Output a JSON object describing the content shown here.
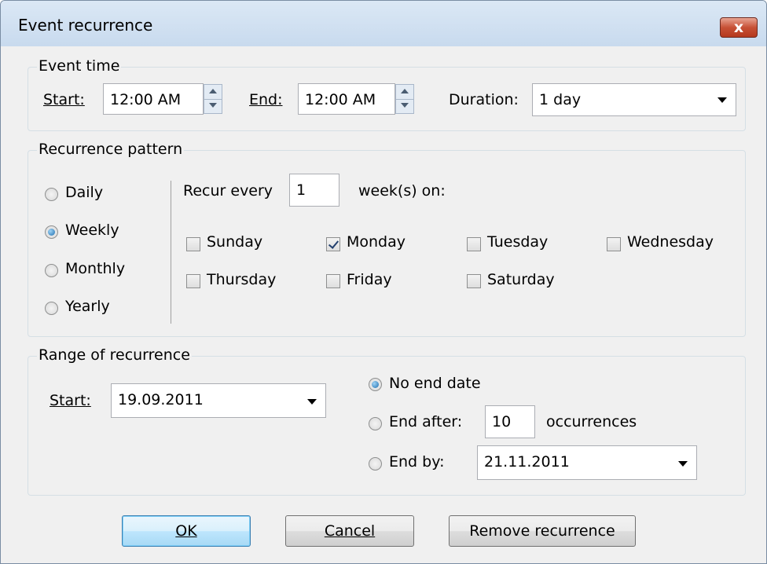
{
  "window": {
    "title": "Event recurrence",
    "close_label": "x"
  },
  "event_time": {
    "legend": "Event time",
    "start_label": "Start:",
    "start_value": "12:00 AM",
    "end_label": "End:",
    "end_value": "12:00 AM",
    "duration_label": "Duration:",
    "duration_value": "1 day"
  },
  "recurrence_pattern": {
    "legend": "Recurrence pattern",
    "types": [
      {
        "label": "Daily",
        "selected": false
      },
      {
        "label": "Weekly",
        "selected": true
      },
      {
        "label": "Monthly",
        "selected": false
      },
      {
        "label": "Yearly",
        "selected": false
      }
    ],
    "recur_every_label": "Recur every",
    "recur_every_value": "1",
    "weeks_on_label": "week(s) on:",
    "days": [
      {
        "label": "Sunday",
        "checked": false
      },
      {
        "label": "Monday",
        "checked": true
      },
      {
        "label": "Tuesday",
        "checked": false
      },
      {
        "label": "Wednesday",
        "checked": false
      },
      {
        "label": "Thursday",
        "checked": false
      },
      {
        "label": "Friday",
        "checked": false
      },
      {
        "label": "Saturday",
        "checked": false
      }
    ]
  },
  "range": {
    "legend": "Range of recurrence",
    "start_label": "Start:",
    "start_value": "19.09.2011",
    "no_end_label": "No end date",
    "end_after_label": "End after:",
    "end_after_value": "10",
    "occurrences_label": "occurrences",
    "end_by_label": "End by:",
    "end_by_value": "21.11.2011",
    "selected": "no_end"
  },
  "buttons": {
    "ok": "OK",
    "cancel": "Cancel",
    "remove": "Remove recurrence"
  },
  "colors": {
    "accent": "#1f6fb0",
    "close_red": "#c75136",
    "window_bg": "#f0f0f0"
  }
}
